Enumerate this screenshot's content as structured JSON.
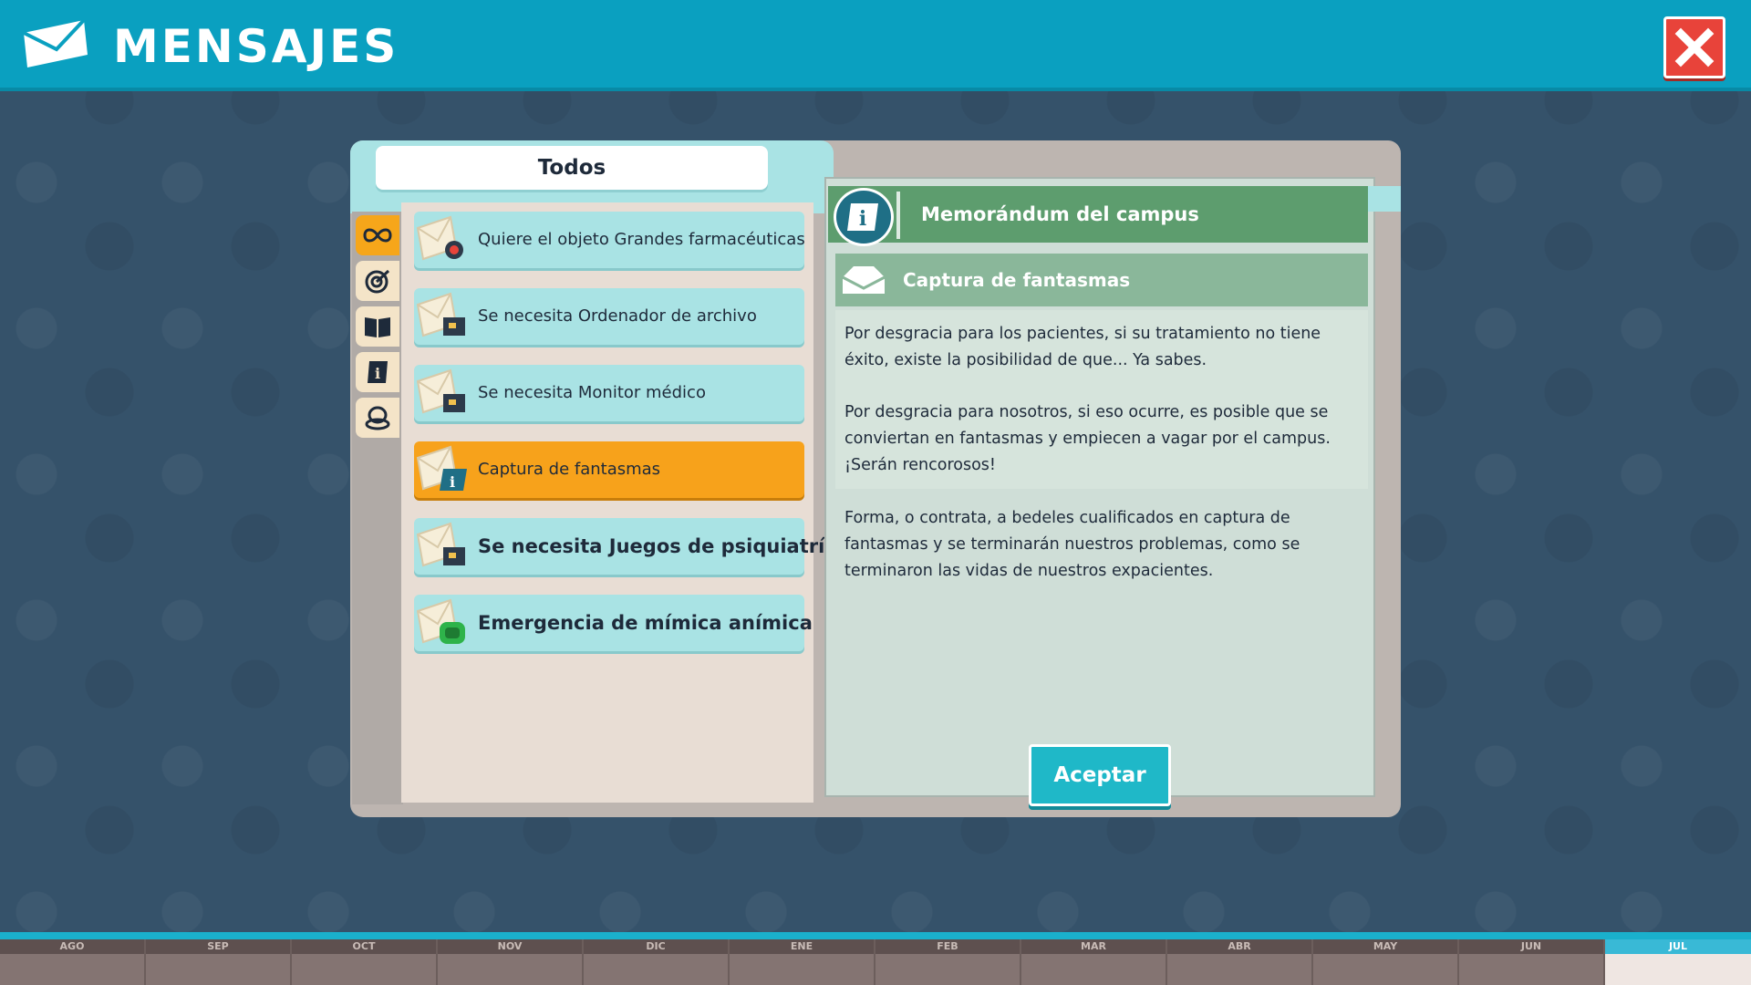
{
  "header": {
    "title": "MENSAJES",
    "close_icon": "close-x-icon"
  },
  "filter": {
    "label": "Todos"
  },
  "categories": [
    {
      "icon": "infinity-icon",
      "active": true
    },
    {
      "icon": "target-icon",
      "active": false
    },
    {
      "icon": "book-icon",
      "active": false
    },
    {
      "icon": "info-book-icon",
      "active": false
    },
    {
      "icon": "coins-icon",
      "active": false
    }
  ],
  "messages": [
    {
      "label": "Quiere el objeto Grandes farmacéuticas",
      "icon": "envelope-target-icon",
      "bold": false,
      "selected": false
    },
    {
      "label": "Se necesita Ordenador de archivo",
      "icon": "envelope-box-icon",
      "bold": false,
      "selected": false
    },
    {
      "label": "Se necesita Monitor médico",
      "icon": "envelope-box-icon",
      "bold": false,
      "selected": false
    },
    {
      "label": "Captura de fantasmas",
      "icon": "envelope-info-icon",
      "bold": false,
      "selected": true
    },
    {
      "label": "Se necesita Juegos de psiquiatría",
      "icon": "envelope-box-icon",
      "bold": true,
      "selected": false
    },
    {
      "label": "Emergencia de mímica anímica",
      "icon": "envelope-green-icon",
      "bold": true,
      "selected": false
    }
  ],
  "detail": {
    "header_title": "Memorándum del campus",
    "subheader_title": "Captura de fantasmas",
    "paragraphs": [
      "Por desgracia para los pacientes, si su tratamiento no tiene éxito, existe la posibilidad de que... Ya sabes.",
      "Por desgracia para nosotros, si eso ocurre, es posible que se conviertan en fantasmas y empiecen a vagar por el campus. ¡Serán rencorosos!",
      "Forma, o contrata, a bedeles cualificados en captura de fantasmas y se terminarán nuestros problemas, como se terminaron las vidas de nuestros expacientes."
    ],
    "accept_label": "Aceptar"
  },
  "timeline": {
    "months": [
      "AGO",
      "SEP",
      "OCT",
      "NOV",
      "DIC",
      "ENE",
      "FEB",
      "MAR",
      "ABR",
      "MAY",
      "JUN",
      "JUL"
    ],
    "current_month": "JUL"
  },
  "colors": {
    "accent_cyan": "#0aa0c0",
    "selected_orange": "#f7a21b",
    "item_teal": "#a9e3e4",
    "header_green": "#5d9d6e",
    "close_red": "#e8433a"
  }
}
